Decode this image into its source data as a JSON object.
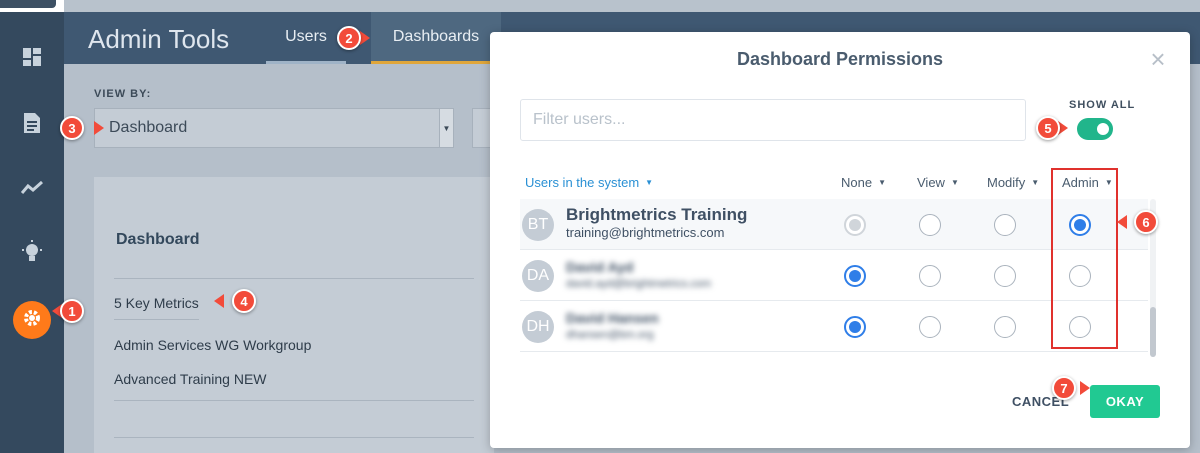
{
  "sidebar": {
    "icons": [
      "dashboard-icon",
      "document-icon",
      "trend-icon",
      "lightbulb-icon",
      "gear-icon"
    ]
  },
  "header": {
    "title": "Admin Tools",
    "tabs": [
      {
        "label": "Users"
      },
      {
        "label": "Dashboards"
      }
    ]
  },
  "background": {
    "view_by_label": "VIEW BY:",
    "view_by_value": "Dashboard",
    "panel_heading": "Dashboard",
    "items": [
      "5 Key Metrics",
      "Admin Services WG Workgroup",
      "Advanced Training NEW"
    ]
  },
  "modal": {
    "title": "Dashboard Permissions",
    "close": "×",
    "filter_placeholder": "Filter users...",
    "show_all_label": "SHOW ALL",
    "show_all_on": true,
    "columns": {
      "users": "Users in the system",
      "none": "None",
      "view": "View",
      "modify": "Modify",
      "admin": "Admin"
    },
    "users": [
      {
        "initials": "BT",
        "name": "Brightmetrics Training",
        "email": "training@brightmetrics.com",
        "permission": "Admin"
      },
      {
        "initials": "DA",
        "name": "David Ayd",
        "email": "david.ayd@brightmetrics.com",
        "permission": "None"
      },
      {
        "initials": "DH",
        "name": "David Hansen",
        "email": "dhansen@bm.org",
        "permission": "None"
      }
    ],
    "cancel_label": "CANCEL",
    "okay_label": "OKAY"
  },
  "callouts": [
    "1",
    "2",
    "3",
    "4",
    "5",
    "6",
    "7"
  ],
  "colors": {
    "sidebar": "#34495e",
    "header": "#3f5872",
    "accent_orange": "#ff7a1a",
    "toggle_green": "#21b58b",
    "okay_green": "#21c992",
    "radio_blue": "#2f7ee8",
    "callout_red": "#f24b3a",
    "highlight_box": "#e0312d"
  }
}
